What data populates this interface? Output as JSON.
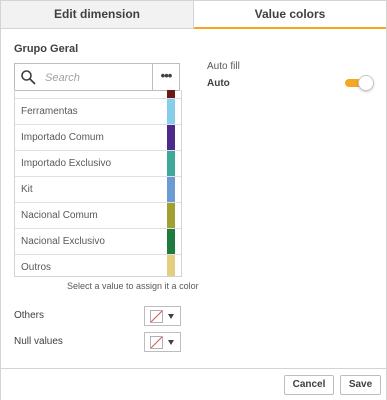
{
  "tabs": [
    {
      "label": "Edit dimension",
      "active": false
    },
    {
      "label": "Value colors",
      "active": true
    }
  ],
  "left": {
    "group_title": "Grupo Geral",
    "search": {
      "placeholder": "Search",
      "value": ""
    },
    "more_label": "•••",
    "items": [
      {
        "label": "",
        "color": "#6b1a1a"
      },
      {
        "label": "Ferramentas",
        "color": "#87ceeb"
      },
      {
        "label": "Importado Comum",
        "color": "#4b2a8a"
      },
      {
        "label": "Importado Exclusivo",
        "color": "#3fa89a"
      },
      {
        "label": "Kit",
        "color": "#6c9bd2"
      },
      {
        "label": "Nacional Comum",
        "color": "#a0a033"
      },
      {
        "label": "Nacional Exclusivo",
        "color": "#1f7a3f"
      },
      {
        "label": "Outros",
        "color": "#e3cf7f"
      }
    ],
    "helper_text": "Select a value to assign it a color",
    "others_label": "Others",
    "null_values_label": "Null values"
  },
  "right": {
    "auto_fill_label": "Auto fill",
    "auto_label": "Auto",
    "toggle_on": true,
    "accent_color": "#f5a623"
  },
  "footer": {
    "cancel_label": "Cancel",
    "save_label": "Save"
  }
}
